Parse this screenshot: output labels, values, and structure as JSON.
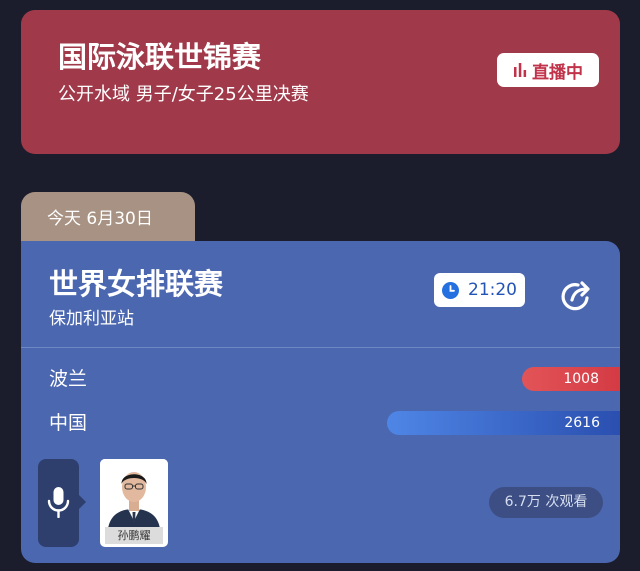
{
  "live_event": {
    "title": "国际泳联世锦赛",
    "subtitle": "公开水域 男子/女子25公里决赛",
    "badge_label": "直播中",
    "badge_icon": "bar-chart-icon",
    "background_color": "#a03a4a"
  },
  "schedule": {
    "date_label": "今天 6月30日"
  },
  "match": {
    "title": "世界女排联赛",
    "subtitle": "保加利亚站",
    "start_time": "21:20",
    "time_icon": "clock-icon",
    "share_icon": "share-icon",
    "background_color": "#4b67b0",
    "teams": [
      {
        "name": "波兰",
        "votes": "1008",
        "bar_color": "#d43b44"
      },
      {
        "name": "中国",
        "votes": "2616",
        "bar_color": "#2a4fb0"
      }
    ],
    "commentator": {
      "name": "孙鹏耀",
      "mic_icon": "microphone-icon"
    },
    "view_count": "6.7万 次观看"
  }
}
